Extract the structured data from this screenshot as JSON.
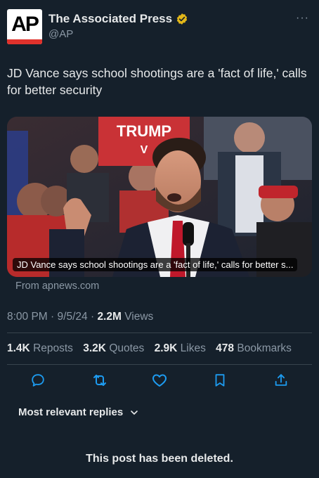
{
  "author": {
    "avatar_text": "AP",
    "name": "The Associated Press",
    "handle": "@AP",
    "verified_color": "#e2b719"
  },
  "more_label": "···",
  "tweet": {
    "text": "JD Vance says school shootings are a 'fact of life,' calls for better security"
  },
  "link_card": {
    "caption": "JD Vance says school shootings are a 'fact of life,' calls for better s...",
    "source": "From apnews.com",
    "sign_text_1": "TRUMP",
    "sign_text_2": "V"
  },
  "meta": {
    "time": "8:00 PM",
    "date": "9/5/24",
    "separator": "·",
    "views_count": "2.2M",
    "views_label": "Views"
  },
  "stats": [
    {
      "count": "1.4K",
      "label": "Reposts"
    },
    {
      "count": "3.2K",
      "label": "Quotes"
    },
    {
      "count": "2.9K",
      "label": "Likes"
    },
    {
      "count": "478",
      "label": "Bookmarks"
    }
  ],
  "actions": {
    "icons": [
      "reply-icon",
      "repost-icon",
      "like-icon",
      "bookmark-icon",
      "share-icon"
    ],
    "icon_color": "#1d9bf0"
  },
  "replies": {
    "sort_label": "Most relevant replies"
  },
  "deleted_notice": "This post has been deleted."
}
